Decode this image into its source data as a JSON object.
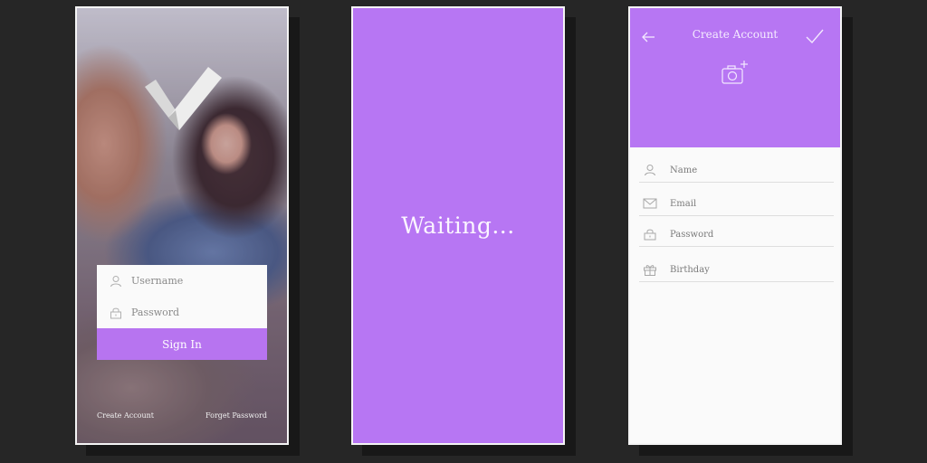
{
  "login_screen": {
    "username_placeholder": "Username",
    "password_placeholder": "Password",
    "signin_label": "Sign In",
    "create_account_link": "Create Account",
    "forget_password_link": "Forget Password",
    "accent_color": "#b774f0"
  },
  "waiting_screen": {
    "message": "Waiting..."
  },
  "create_account_screen": {
    "title": "Create Account",
    "fields": [
      {
        "label": "Name",
        "icon": "user-icon"
      },
      {
        "label": "Email",
        "icon": "mail-icon"
      },
      {
        "label": "Password",
        "icon": "lock-icon"
      },
      {
        "label": "Birthday",
        "icon": "gift-icon"
      }
    ],
    "header_color": "#b776f3"
  }
}
